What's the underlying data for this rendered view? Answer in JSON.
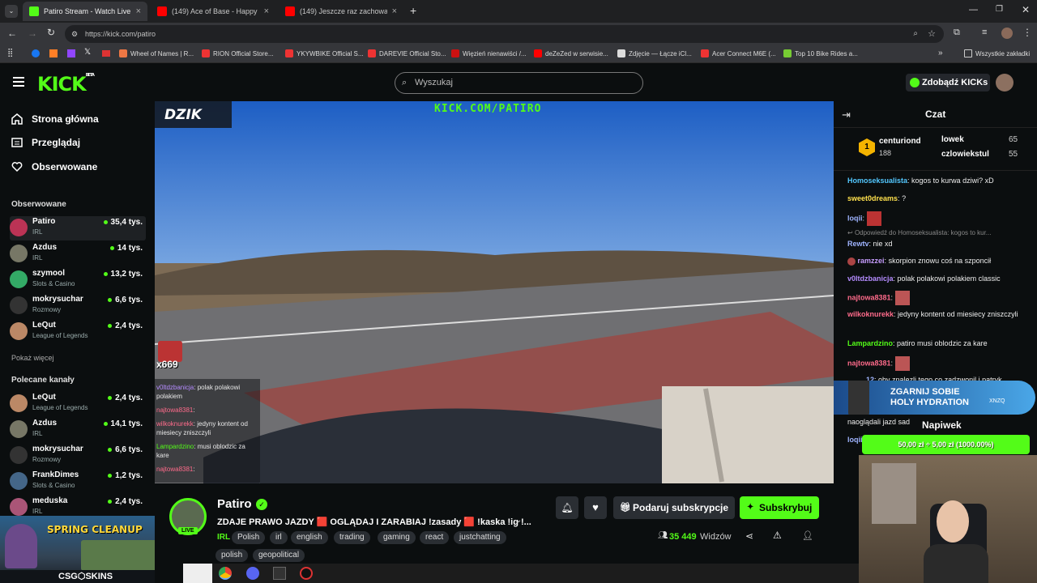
{
  "browser": {
    "tabs": [
      {
        "title": "Patiro Stream - Watch Live on K",
        "color": "#53fc18",
        "active": true
      },
      {
        "title": "(149) Ace of Base - Happy Natio",
        "color": "#ff0000",
        "active": false
      },
      {
        "title": "(149) Jeszcze raz zachowasz się",
        "color": "#ff0000",
        "active": false
      }
    ],
    "url": "https://kick.com/patiro",
    "bookmarks": [
      {
        "label": "Wheel of Names | R..."
      },
      {
        "label": "RION Official Store..."
      },
      {
        "label": "YKYWBIKE Official S..."
      },
      {
        "label": "DAREVIE Official Sto..."
      },
      {
        "label": "Więzień nienawiści /..."
      },
      {
        "label": "deZeZed w serwisie..."
      },
      {
        "label": "Zdjęcie — Łącze iCl..."
      },
      {
        "label": "Acer Connect M6E (..."
      },
      {
        "label": "Top 10 Bike Rides a..."
      }
    ],
    "all_bookmarks": "Wszystkie zakładki"
  },
  "header": {
    "logo": "KICK",
    "logo_sup": "BETA",
    "search_placeholder": "Wyszukaj",
    "kicks_button": "Zdobądź KICKs"
  },
  "sidebar": {
    "nav": [
      {
        "label": "Strona główna"
      },
      {
        "label": "Przeglądaj"
      },
      {
        "label": "Obserwowane"
      }
    ],
    "followed_title": "Obserwowane",
    "followed": [
      {
        "name": "Patiro",
        "category": "IRL",
        "viewers": "35,4 tys."
      },
      {
        "name": "Azdus",
        "category": "IRL",
        "viewers": "14 tys."
      },
      {
        "name": "szymool",
        "category": "Slots & Casino",
        "viewers": "13,2 tys."
      },
      {
        "name": "mokrysuchar",
        "category": "Rozmowy",
        "viewers": "6,6 tys."
      },
      {
        "name": "LeQut",
        "category": "League of Legends",
        "viewers": "2,4 tys."
      }
    ],
    "show_more": "Pokaż więcej",
    "recommended_title": "Polecane kanały",
    "recommended": [
      {
        "name": "LeQut",
        "category": "League of Legends",
        "viewers": "2,4 tys."
      },
      {
        "name": "Azdus",
        "category": "IRL",
        "viewers": "14,1 tys."
      },
      {
        "name": "mokrysuchar",
        "category": "Rozmowy",
        "viewers": "6,6 tys."
      },
      {
        "name": "FrankDimes",
        "category": "Slots & Casino",
        "viewers": "1,2 tys."
      },
      {
        "name": "meduska",
        "category": "IRL",
        "viewers": "2,4 tys."
      }
    ],
    "ad_title": "SPRING CLEANUP",
    "ad_brand": "CSG⬡SKINS"
  },
  "video": {
    "watermark_logo": "DZIK",
    "overlay_url": "KICK.COM/PATIRO",
    "overlay_count": "x669",
    "overlay_chat": [
      {
        "user": "v0ltdzbanicja",
        "text": ": polak polakowi polakiem"
      },
      {
        "user": "najtowa8381",
        "text": ":"
      },
      {
        "user": "wilkoknurekk",
        "text": ": jedyny kontent od miesiecy zniszczyli"
      },
      {
        "user": "Lampardzino",
        "text": ": musi oblodzic za kare"
      },
      {
        "user": "najtowa8381",
        "text": ":"
      }
    ]
  },
  "stream_info": {
    "live_badge": "LIVE",
    "streamer": "Patiro",
    "title": "ZDAJE PRAWO JAZDY 🟥 OGLĄDAJ I ZARABIAJ !zasady 🟥 !kaska !ig !...",
    "category": "IRL",
    "tags": [
      "Polish",
      "irl",
      "english",
      "trading",
      "gaming",
      "react",
      "justchatting",
      "polish",
      "geopolitical"
    ],
    "gift_button": "Podaruj subskrypcje",
    "subscribe_button": "Subskrybuj",
    "viewers": "35 449",
    "viewers_label": "Widzów"
  },
  "chat": {
    "title": "Czat",
    "leaderboard": [
      {
        "name": "centuriond",
        "count": "188"
      },
      {
        "name": "lowek",
        "count": "65"
      },
      {
        "name": "czlowiekstul",
        "count": "55"
      }
    ],
    "messages": [
      {
        "user": "Homoseksualista",
        "color": "#53c8ff",
        "text": "kogos to kurwa dziwi? xD"
      },
      {
        "user": "sweet0dreams",
        "color": "#ffe14d",
        "text": "?"
      },
      {
        "user": "loqii",
        "color": "#9fb4ff",
        "text": ""
      },
      {
        "user": "Odpowiedź do Homoseksualista: kogos to kur...",
        "color": "#888888",
        "text": ""
      },
      {
        "user": "Rewtv",
        "color": "#9fb4ff",
        "text": "nie xd"
      },
      {
        "user": "ramzzei",
        "color": "#c79dff",
        "text": "skorpion znowu coś na szponcił"
      },
      {
        "user": "v0ltdzbanicja",
        "color": "#b58cff",
        "text": "polak polakowi polakiem classic"
      },
      {
        "user": "najtowa8381",
        "color": "#ff6b8b",
        "text": ""
      },
      {
        "user": "wilkoknurekk",
        "color": "#ff6b8b",
        "text": "jedyny kontent od miesiecy zniszczyli"
      },
      {
        "user": "Lampardzino",
        "color": "#53fc18",
        "text": "patiro musi oblodzic za kare"
      },
      {
        "user": "najtowa8381",
        "color": "#ff6b8b",
        "text": ""
      },
      {
        "user": "12",
        "color": "#9fb4ff",
        "text": "oby znalezli tego co zadzwonil i patryk"
      },
      {
        "user": "",
        "color": "#eeeeee",
        "text": "naoglądali jazd sad"
      },
      {
        "user": "loqii",
        "color": "#9fb4ff",
        "text": ""
      }
    ],
    "banner": "ZGARNIJ SOBIE HOLY HYDRATION",
    "banner_code": "XNZQ",
    "napiwek_title": "Napiwek",
    "napiwek_amount": "50,00 zł ÷ 5,00 zł (1000.00%)"
  }
}
